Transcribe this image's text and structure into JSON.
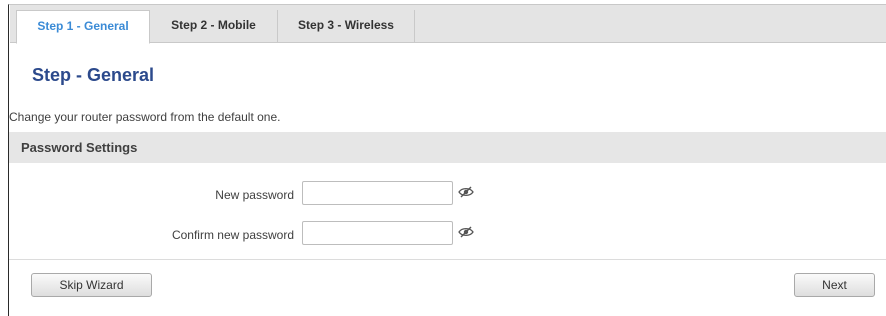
{
  "tabs": [
    {
      "label": "Step 1 - General",
      "active": true
    },
    {
      "label": "Step 2 - Mobile",
      "active": false
    },
    {
      "label": "Step 3 - Wireless",
      "active": false
    }
  ],
  "page": {
    "title": "Step - General",
    "description": "Change your router password from the default one."
  },
  "section": {
    "title": "Password Settings"
  },
  "fields": {
    "new_password": {
      "label": "New password",
      "value": "",
      "icon": "eye-slash-icon"
    },
    "confirm_password": {
      "label": "Confirm new password",
      "value": "",
      "icon": "eye-slash-icon"
    }
  },
  "buttons": {
    "skip": "Skip Wizard",
    "next": "Next"
  },
  "colors": {
    "active_tab_text": "#3b8bd6",
    "title": "#2c4a8c",
    "section_bg": "#e6e6e6",
    "tabbar_bg": "#e4e4e4"
  }
}
